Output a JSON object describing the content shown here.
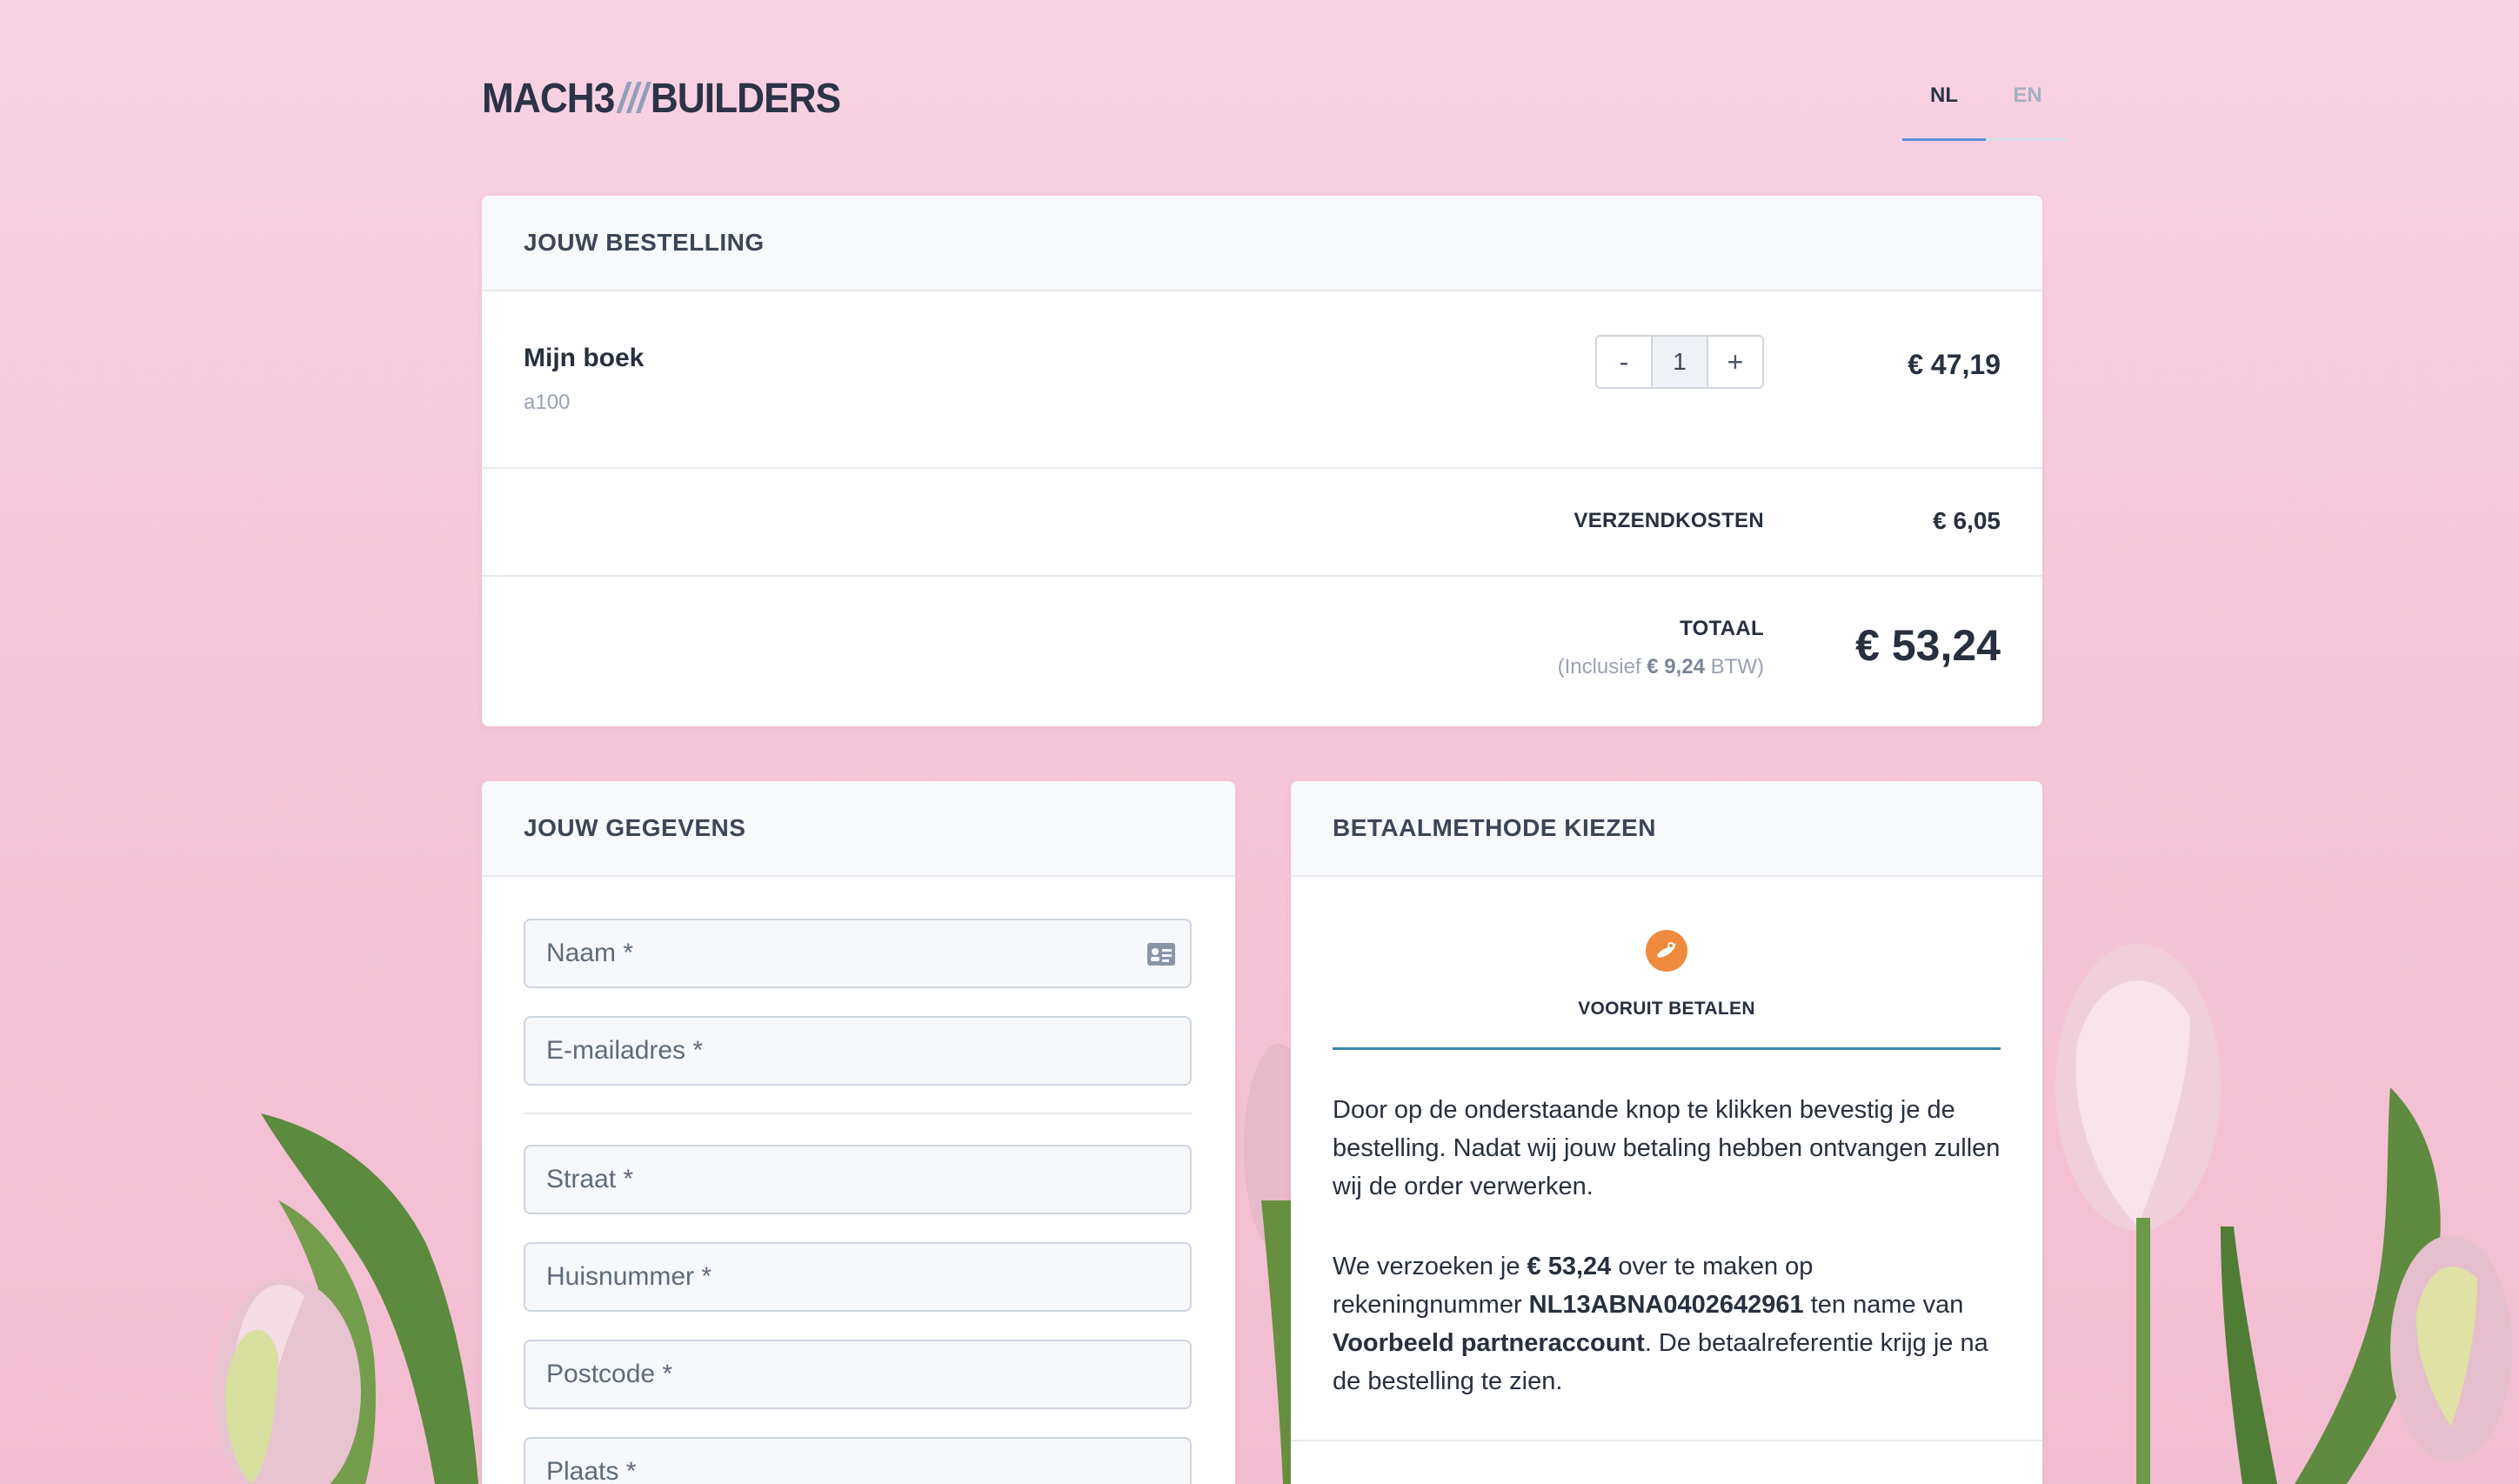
{
  "brand": {
    "part1": "MACH3",
    "separator": "///",
    "part2": "BUILDERS"
  },
  "languages": [
    {
      "code": "NL",
      "active": true
    },
    {
      "code": "EN",
      "active": false
    }
  ],
  "order": {
    "header": "JOUW BESTELLING",
    "product": {
      "name": "Mijn boek",
      "sku": "a100",
      "quantity": "1",
      "decrement": "-",
      "increment": "+",
      "price": "€ 47,19"
    },
    "shipping": {
      "label": "VERZENDKOSTEN",
      "value": "€ 6,05"
    },
    "total": {
      "label": "TOTAAL",
      "vat_prefix": "(Inclusief ",
      "vat_amount": "€ 9,24",
      "vat_suffix": " BTW)",
      "value": "€ 53,24"
    }
  },
  "details": {
    "header": "JOUW GEGEVENS",
    "fields": [
      {
        "placeholder": "Naam *",
        "icon": "id-card-icon"
      },
      {
        "placeholder": "E-mailadres *"
      },
      {
        "placeholder": "Straat *"
      },
      {
        "placeholder": "Huisnummer *"
      },
      {
        "placeholder": "Postcode *"
      },
      {
        "placeholder": "Plaats *"
      }
    ]
  },
  "payment": {
    "header": "BETAALMETHODE KIEZEN",
    "method_label": "VOORUIT BETALEN",
    "method_icon": "prepay-icon",
    "accent_color": "#3e84a8",
    "icon_color": "#f08a3c",
    "para1": "Door op de onderstaande knop te klikken bevestig je de bestelling. Nadat wij jouw betaling hebben ontvangen zullen wij de order verwerken.",
    "para2": {
      "t1": "We verzoeken je ",
      "amount": "€ 53,24",
      "t2": " over te maken op rekeningnummer ",
      "iban": "NL13ABNA0402642961",
      "t3": " ten name van ",
      "holder": "Voorbeeld partneraccount",
      "t4": ". De betaalreferentie krijg je na de bestelling te zien."
    }
  }
}
